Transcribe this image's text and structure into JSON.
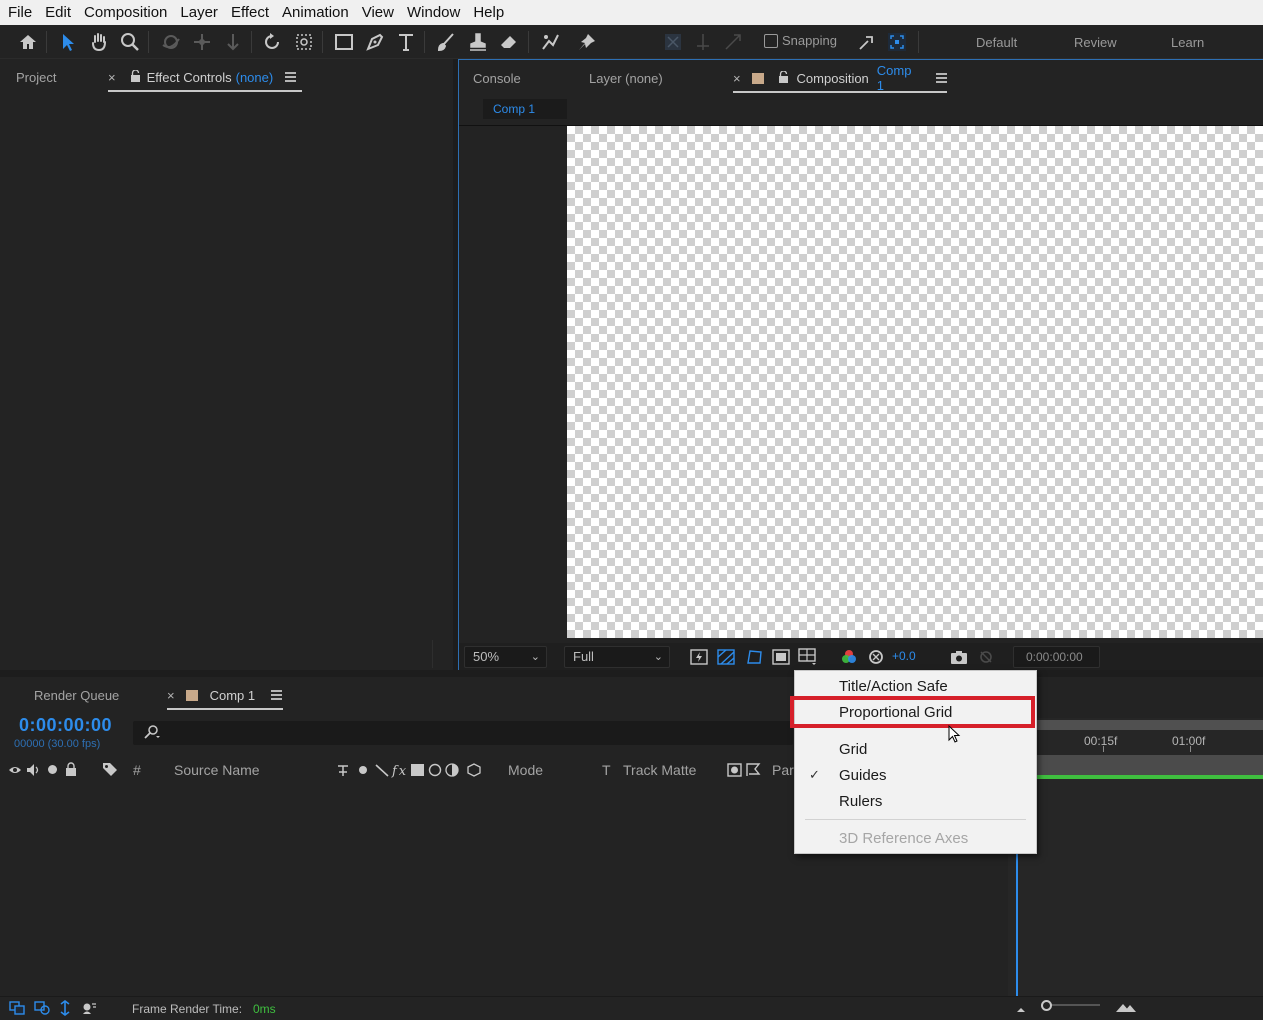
{
  "menubar": [
    "File",
    "Edit",
    "Composition",
    "Layer",
    "Effect",
    "Animation",
    "View",
    "Window",
    "Help"
  ],
  "toolbar": {
    "snapping_label": "Snapping",
    "workspaces": [
      "Default",
      "Review",
      "Learn"
    ]
  },
  "left_panel": {
    "project_tab": "Project",
    "effect_controls_tab": "Effect Controls",
    "effect_controls_value": "(none)"
  },
  "viewer": {
    "console_tab": "Console",
    "layer_tab": "Layer (none)",
    "comp_tab_prefix": "Composition",
    "comp_tab_name": "Comp 1",
    "breadcrumb": "Comp 1",
    "zoom": "50%",
    "resolution": "Full",
    "exposure": "+0.0",
    "timecode": "0:00:00:00"
  },
  "timeline": {
    "render_queue_tab": "Render Queue",
    "comp_tab": "Comp 1",
    "current_time": "0:00:00:00",
    "frame_info": "00000 (30.00 fps)",
    "col_hash": "#",
    "col_source": "Source Name",
    "col_mode": "Mode",
    "col_t": "T",
    "col_track_matte": "Track Matte",
    "col_parent": "Par",
    "ruler": [
      "00:15f",
      "01:00f"
    ]
  },
  "context_menu": {
    "items": [
      "Title/Action Safe",
      "Proportional Grid",
      "Grid",
      "Guides",
      "Rulers",
      "3D Reference Axes"
    ],
    "checked": "Guides",
    "highlighted": "Proportional Grid",
    "disabled": "3D Reference Axes"
  },
  "status": {
    "label": "Frame Render Time:",
    "value": "0ms"
  },
  "colors": {
    "accent_blue": "#2d8ceb",
    "highlight_red": "#d6202a",
    "timeline_green": "#3fbf3f",
    "comp_swatch": "#c8a98a"
  }
}
